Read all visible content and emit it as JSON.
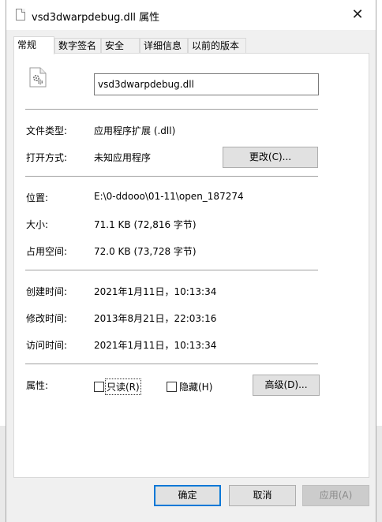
{
  "window": {
    "title": "vsd3dwarpdebug.dll 属性",
    "close_label": "✕"
  },
  "tabs": [
    {
      "label": "常规",
      "active": true
    },
    {
      "label": "数字签名",
      "active": false
    },
    {
      "label": "安全",
      "active": false
    },
    {
      "label": "详细信息",
      "active": false
    },
    {
      "label": "以前的版本",
      "active": false
    }
  ],
  "general": {
    "filename": "vsd3dwarpdebug.dll",
    "file_type_label": "文件类型:",
    "file_type_value": "应用程序扩展 (.dll)",
    "opens_with_label": "打开方式:",
    "opens_with_value": "未知应用程序",
    "change_button": "更改(C)...",
    "location_label": "位置:",
    "location_value": "E:\\0-ddooo\\01-11\\open_187274",
    "size_label": "大小:",
    "size_value": "71.1 KB (72,816 字节)",
    "size_on_disk_label": "占用空间:",
    "size_on_disk_value": "72.0 KB (73,728 字节)",
    "created_label": "创建时间:",
    "created_value": "2021年1月11日，10:13:34",
    "modified_label": "修改时间:",
    "modified_value": "2013年8月21日，22:03:16",
    "accessed_label": "访问时间:",
    "accessed_value": "2021年1月11日，10:13:34",
    "attributes_label": "属性:",
    "readonly_label": "只读(R)",
    "readonly_checked": false,
    "hidden_label": "隐藏(H)",
    "hidden_checked": false,
    "advanced_button": "高级(D)..."
  },
  "footer": {
    "ok": "确定",
    "cancel": "取消",
    "apply": "应用(A)"
  },
  "icons": {
    "title_icon": "document-icon",
    "file_icon": "gear-document-icon"
  },
  "colors": {
    "accent": "#0078d7",
    "window_bg": "#f0f0f0",
    "panel_bg": "#ffffff"
  }
}
